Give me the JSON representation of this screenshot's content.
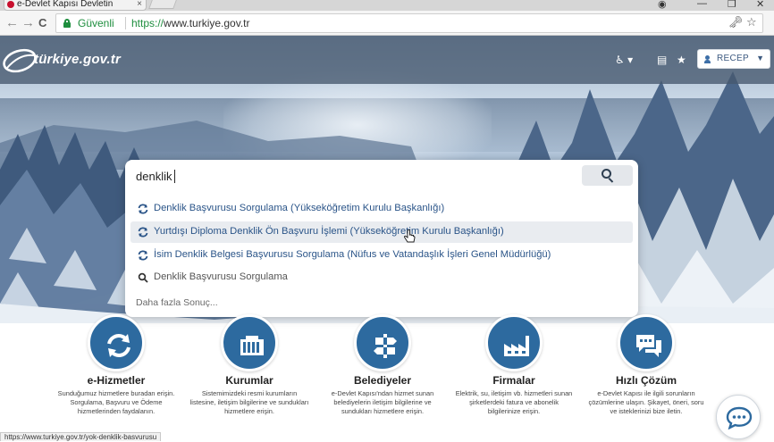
{
  "browser": {
    "tab_title": "e-Devlet Kapısı Devletin",
    "tab_close": "×",
    "secure_label": "Güvenli",
    "url_scheme": "https://",
    "url_rest": "www.turkiye.gov.tr",
    "back_glyph": "←",
    "forward_glyph": "→",
    "reload_glyph": "C",
    "status_url": "https://www.turkiye.gov.tr/yok-denklik-basvurusu"
  },
  "site": {
    "logo_text": "türkiye.gov.tr",
    "user_name": "RECEP",
    "accent": "#2d6a9f"
  },
  "search": {
    "query": "denklik",
    "suggestions": [
      {
        "label": "Denklik Başvurusu Sorgulama (Yükseköğretim Kurulu Başkanlığı)",
        "icon": "service-sync-icon",
        "highlighted": false
      },
      {
        "label": "Yurtdışı Diploma Denklik Ön Başvuru İşlemi (Yükseköğretim Kurulu Başkanlığı)",
        "icon": "service-sync-icon",
        "highlighted": true
      },
      {
        "label": "İsim Denklik Belgesi Başvurusu Sorgulama (Nüfus ve Vatandaşlık İşleri Genel Müdürlüğü)",
        "icon": "service-sync-icon",
        "highlighted": false
      },
      {
        "label": "Denklik Başvurusu Sorgulama",
        "icon": "search-icon",
        "highlighted": false
      }
    ],
    "more_label": "Daha fazla Sonuç..."
  },
  "services": [
    {
      "title": "e-Hizmetler",
      "desc": "Sunduğumuz hizmetlere buradan erişin. Sorgulama, Başvuru ve Ödeme hizmetlerinden faydalanın.",
      "icon": "sync-arrows-icon"
    },
    {
      "title": "Kurumlar",
      "desc": "Sistemimizdeki resmi kurumların listesine, iletişim bilgilerine ve sundukları hizmetlere erişin.",
      "icon": "building-icon"
    },
    {
      "title": "Belediyeler",
      "desc": "e-Devlet Kapısı'ndan hizmet sunan belediyelerin iletişim bilgilerine ve sundukları hizmetlere erişin.",
      "icon": "signpost-icon"
    },
    {
      "title": "Firmalar",
      "desc": "Elektrik, su, iletişim vb. hizmetleri sunan şirketlerdeki fatura ve abonelik bilgilerinize erişin.",
      "icon": "factory-icon"
    },
    {
      "title": "Hızlı Çözüm",
      "desc": "e-Devlet Kapısı ile ilgili sorunların çözümlerine ulaşın. Şikayet, öneri, soru ve isteklerinizi bize iletin.",
      "icon": "chat-bubbles-icon"
    }
  ]
}
